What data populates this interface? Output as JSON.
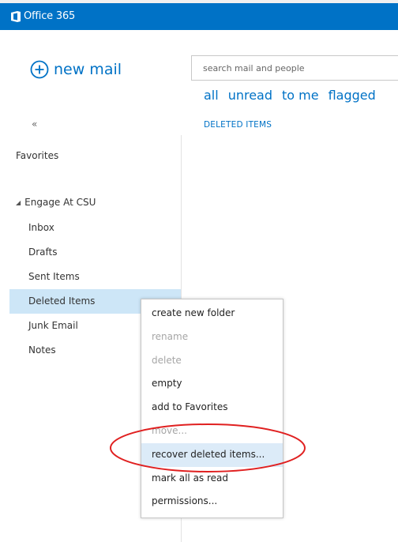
{
  "suite": {
    "title": "Office 365"
  },
  "new_mail": {
    "label": "new mail"
  },
  "search": {
    "placeholder": "search mail and people"
  },
  "filters": [
    "all",
    "unread",
    "to me",
    "flagged"
  ],
  "nav": {
    "collapse_glyph": "«",
    "favorites": "Favorites",
    "account": "Engage At CSU",
    "folders": [
      "Inbox",
      "Drafts",
      "Sent Items",
      "Deleted Items",
      "Junk Email",
      "Notes"
    ],
    "selected": "Deleted Items"
  },
  "folder_heading": "DELETED ITEMS",
  "context_menu": {
    "items": [
      {
        "label": "create new folder",
        "enabled": true
      },
      {
        "label": "rename",
        "enabled": false
      },
      {
        "label": "delete",
        "enabled": false
      },
      {
        "label": "empty",
        "enabled": true
      },
      {
        "label": "add to Favorites",
        "enabled": true
      },
      {
        "label": "move...",
        "enabled": false
      },
      {
        "label": "recover deleted items...",
        "enabled": true,
        "highlighted": true
      },
      {
        "label": "mark all as read",
        "enabled": true
      },
      {
        "label": "permissions...",
        "enabled": true
      }
    ]
  },
  "colors": {
    "brand": "#0072c6",
    "selected_bg": "#cde6f7",
    "annotation": "#e02020"
  }
}
